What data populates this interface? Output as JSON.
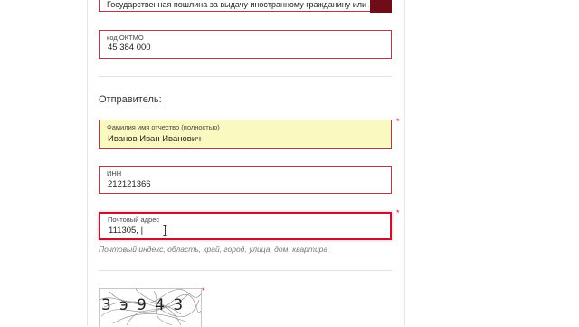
{
  "payment_purpose": {
    "value": "Государственная пошлина за выдачу иностранному гражданину или л..."
  },
  "oktmo": {
    "label": "код ОКТМО",
    "value": "45 384 000"
  },
  "sender": {
    "title": "Отправитель:",
    "full_name": {
      "label": "Фамилия имя отчество (полностью)",
      "value": "Иванов Иван Иванович"
    },
    "inn": {
      "label": "ИНН",
      "value": "212121366"
    },
    "address": {
      "label": "Почтовый адрес",
      "value": "111305, |",
      "hint": "Почтовый индекс, область, край, город, улица, дом, квартира"
    }
  },
  "captcha": {
    "text": "3 э 9 4 3"
  },
  "required_mark": "*",
  "colors": {
    "accent": "#c4122f",
    "field_border": "#b03a48",
    "highlight_fill": "#fafac0",
    "dark_button": "#6e0c18"
  },
  "icons": [
    "text-cursor-icon"
  ]
}
